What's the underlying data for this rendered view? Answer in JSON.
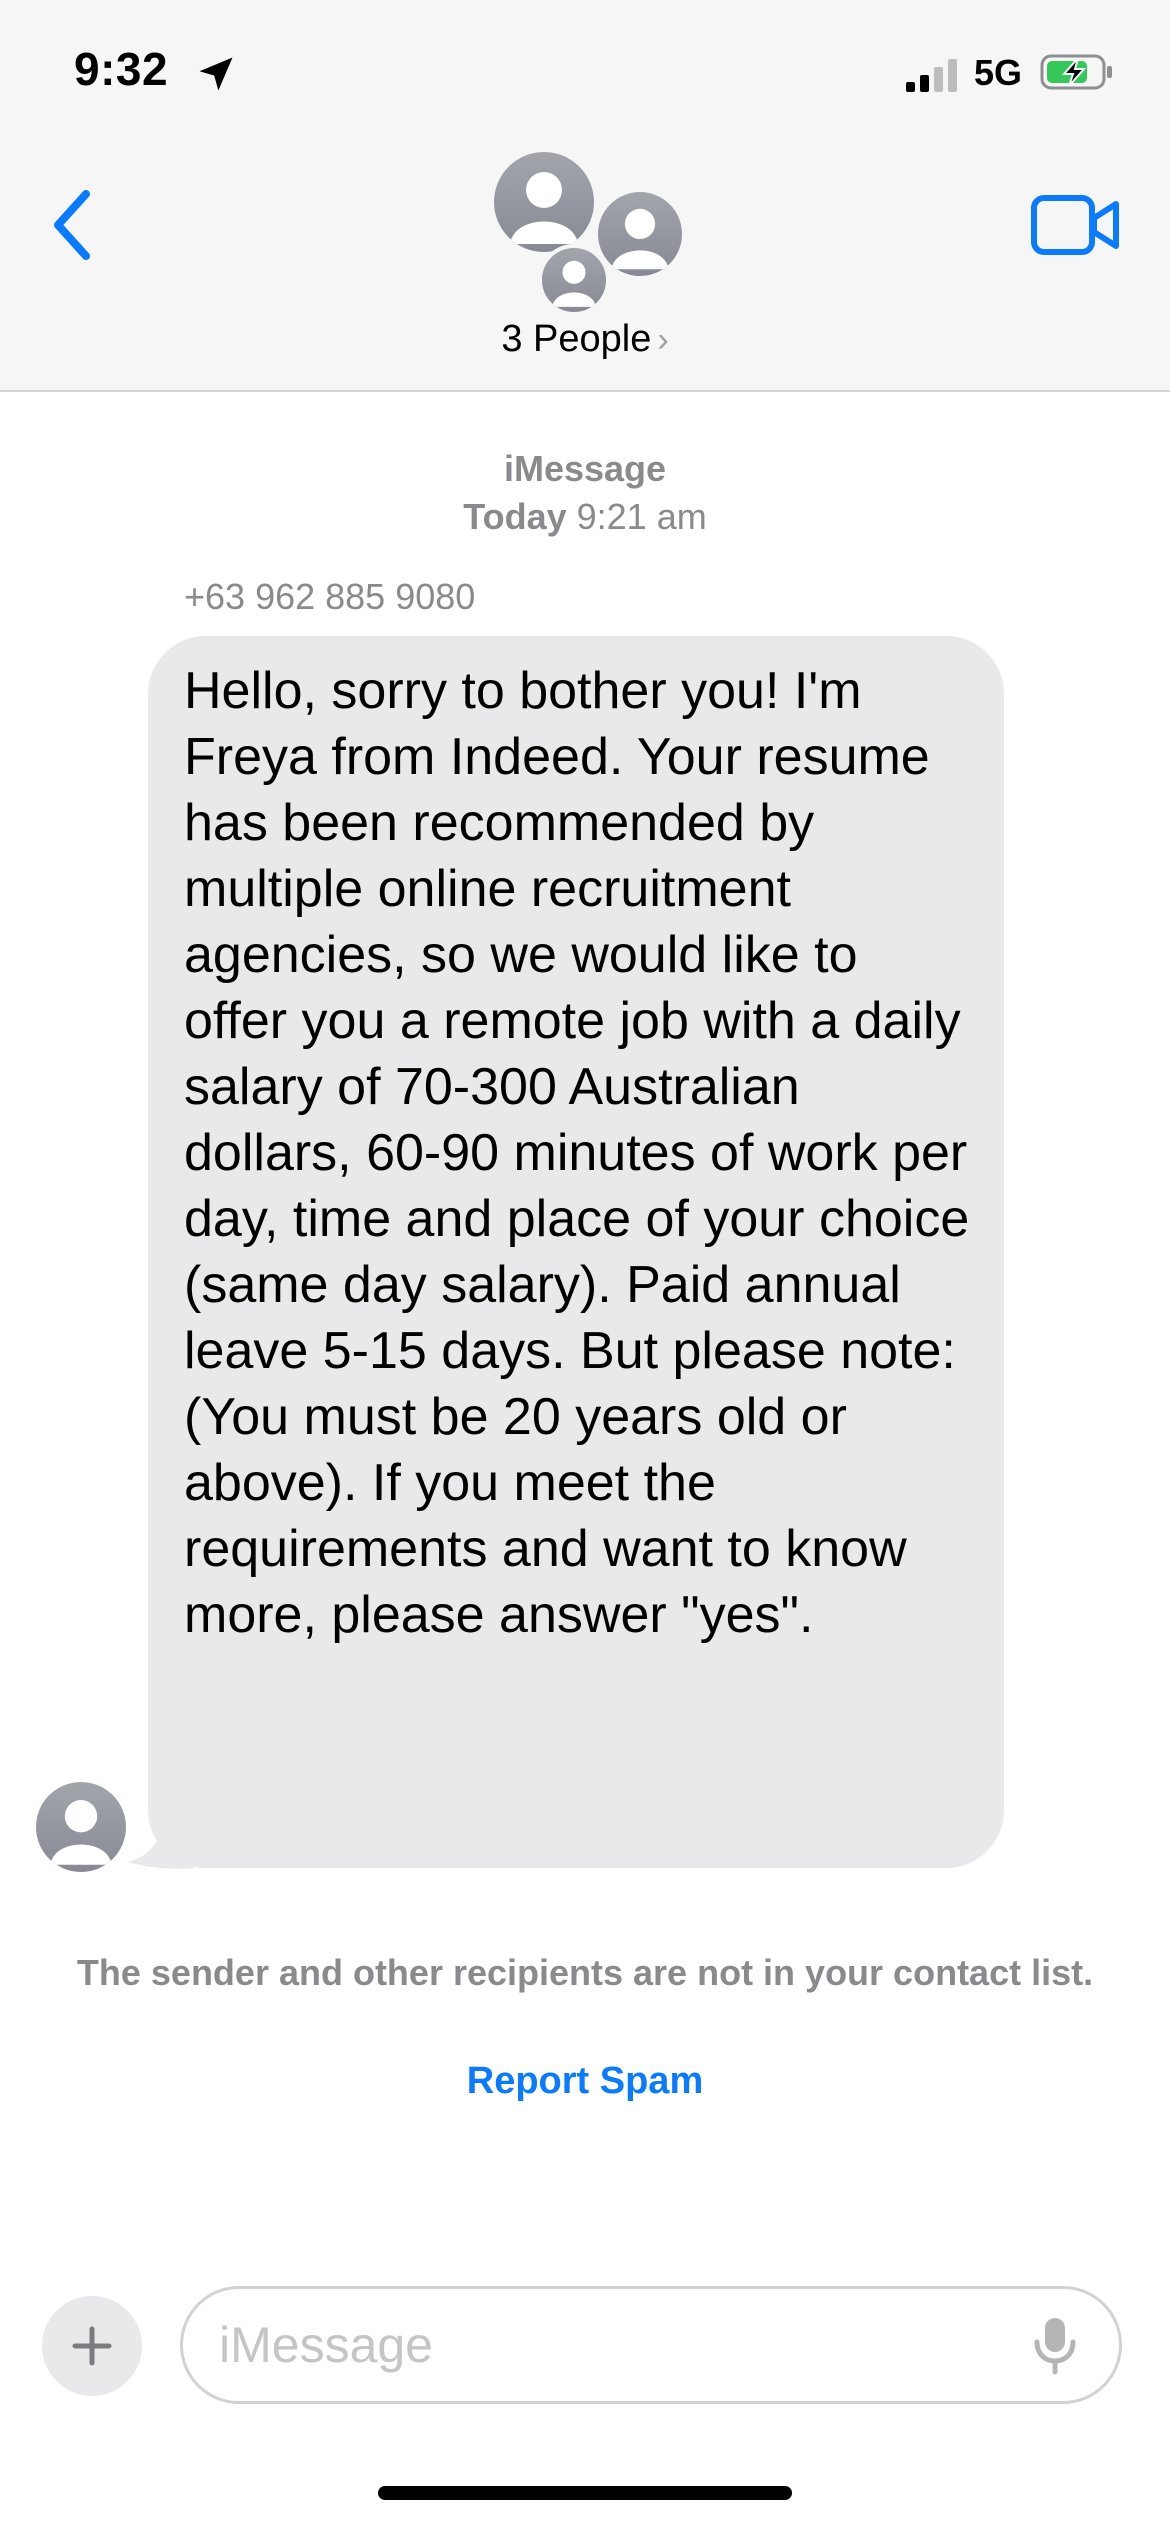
{
  "status_bar": {
    "time": "9:32",
    "network": "5G",
    "icons": [
      "location-arrow-icon",
      "signal-bars-icon",
      "battery-charging-icon"
    ]
  },
  "nav": {
    "back_icon": "chevron-left-icon",
    "video_icon": "video-camera-icon",
    "group_avatar_icon": "group-avatar-icon",
    "title": "3 People",
    "title_chevron": "›"
  },
  "conversation": {
    "service": "iMessage",
    "timestamp_day": "Today",
    "timestamp_time": "9:21 am",
    "sender": "+63 962 885 9080",
    "messages": [
      {
        "direction": "incoming",
        "text": "Hello, sorry to bother you! I'm Freya from Indeed. Your resume has been recommended by multiple online recruitment agencies, so we would like to offer you a remote job with a daily salary of 70-300 Australian dollars, 60-90 minutes of work per day, time and place of your choice (same day salary). Paid annual leave 5-15 days. But please note: (You must be 20 years old or above). If you meet the requirements and want to know more, please answer \"yes\"."
      }
    ],
    "notice": "The sender and other recipients are not in your contact list.",
    "report_spam_label": "Report Spam"
  },
  "composer": {
    "placeholder": "iMessage",
    "value": "",
    "plus_icon": "plus-icon",
    "mic_icon": "microphone-icon"
  },
  "colors": {
    "accent": "#0a7aff",
    "bubble_incoming": "#e9e9eb",
    "secondary_text": "#8a8a8e",
    "header_bg": "#f6f6f6"
  }
}
